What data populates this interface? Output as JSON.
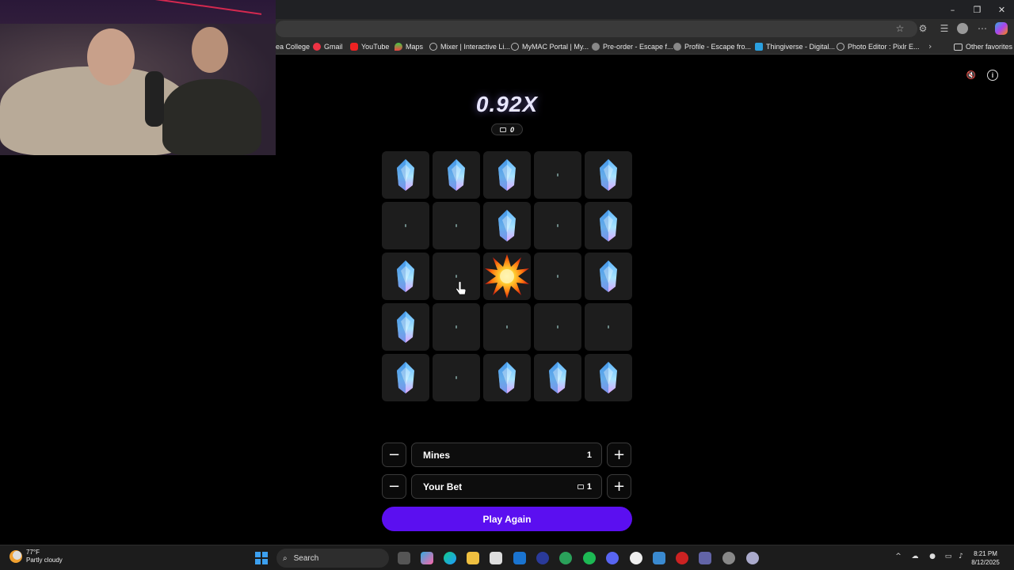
{
  "browser": {
    "window_controls": [
      "–",
      "❐",
      "✕"
    ],
    "bookmarks": [
      {
        "label": "ea College",
        "icon": "globe-icon"
      },
      {
        "label": "Gmail",
        "icon": "gmail-icon"
      },
      {
        "label": "YouTube",
        "icon": "youtube-icon"
      },
      {
        "label": "Maps",
        "icon": "maps-icon"
      },
      {
        "label": "Mixer | Interactive Li...",
        "icon": "globe-icon"
      },
      {
        "label": "MyMAC Portal | My...",
        "icon": "globe-icon"
      },
      {
        "label": "Pre-order - Escape f...",
        "icon": "game-icon"
      },
      {
        "label": "Profile - Escape fro...",
        "icon": "game-icon"
      },
      {
        "label": "Thingiverse - Digital...",
        "icon": "thingiverse-icon"
      },
      {
        "label": "Photo Editor : Pixlr E...",
        "icon": "globe-icon"
      }
    ],
    "other_favorites": "Other favorites"
  },
  "game": {
    "multiplier": "0.92X",
    "balance": "0",
    "board": [
      [
        "gem",
        "gem",
        "gem",
        "hidden",
        "gem"
      ],
      [
        "hidden",
        "hidden",
        "gem",
        "hidden",
        "gem"
      ],
      [
        "gem",
        "hidden",
        "mine",
        "hidden",
        "gem"
      ],
      [
        "gem",
        "hidden",
        "hidden",
        "hidden",
        "hidden"
      ],
      [
        "gem",
        "hidden",
        "gem",
        "gem",
        "gem"
      ]
    ],
    "mines_label": "Mines",
    "mines_value": "1",
    "bet_label": "Your Bet",
    "bet_value": "1",
    "minus_symbol": "−",
    "plus_symbol": "+",
    "play_again_label": "Play Again",
    "info_symbol": "i",
    "mute_symbol": "🔇"
  },
  "taskbar": {
    "weather_temp": "77°F",
    "weather_desc": "Partly cloudy",
    "search_label": "Search",
    "time": "8:21 PM",
    "date": "8/12/2025"
  },
  "colors": {
    "accent": "#5b0ff0",
    "tile": "#1d1d1d",
    "page_bg": "#000000"
  }
}
